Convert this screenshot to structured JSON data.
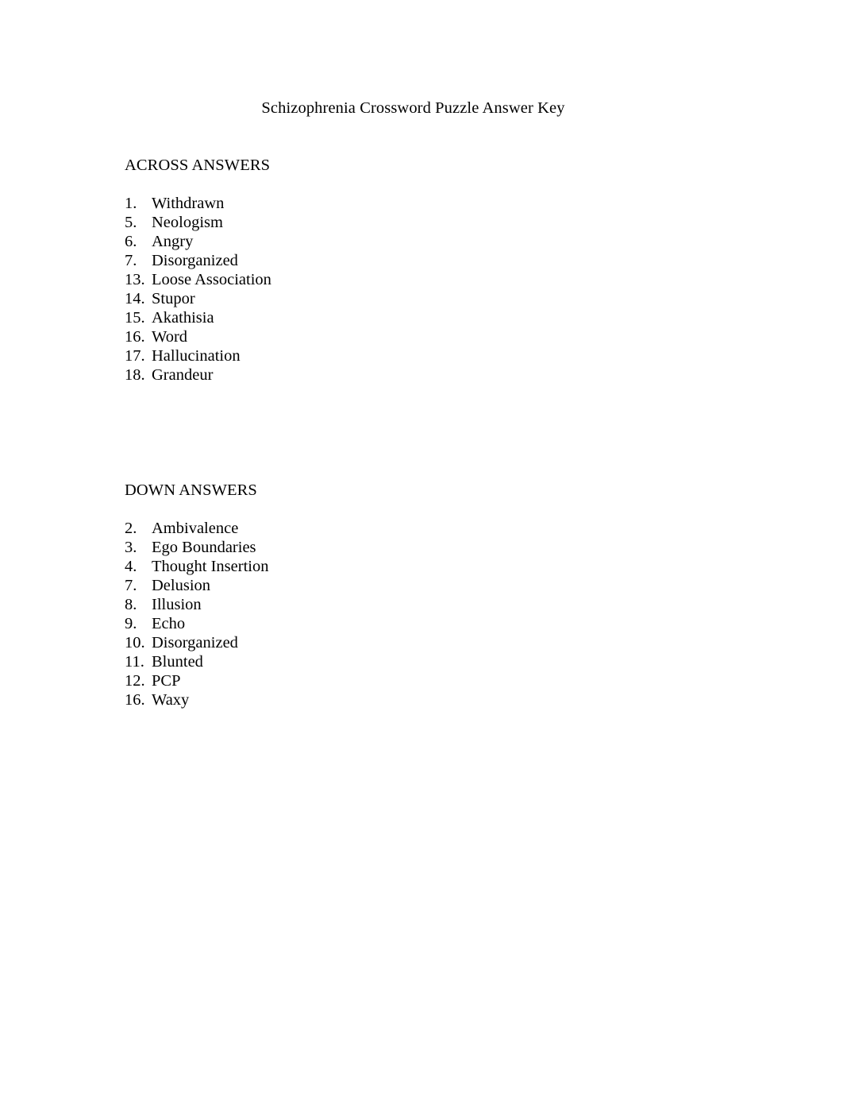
{
  "document": {
    "title": "Schizophrenia Crossword Puzzle Answer Key",
    "background_color": "#ffffff",
    "text_color": "#000000"
  },
  "across": {
    "heading": "ACROSS ANSWERS",
    "items": [
      {
        "number": "1.",
        "answer": "Withdrawn"
      },
      {
        "number": "5.",
        "answer": "Neologism"
      },
      {
        "number": "6.",
        "answer": "Angry"
      },
      {
        "number": "7.",
        "answer": "Disorganized"
      },
      {
        "number": "13.",
        "answer": "Loose Association"
      },
      {
        "number": "14.",
        "answer": "Stupor"
      },
      {
        "number": "15.",
        "answer": "Akathisia"
      },
      {
        "number": "16.",
        "answer": "Word"
      },
      {
        "number": "17.",
        "answer": "Hallucination"
      },
      {
        "number": "18.",
        "answer": "Grandeur"
      }
    ]
  },
  "down": {
    "heading": "DOWN ANSWERS",
    "items": [
      {
        "number": "2.",
        "answer": "Ambivalence"
      },
      {
        "number": "3.",
        "answer": "Ego Boundaries"
      },
      {
        "number": "4.",
        "answer": "Thought Insertion"
      },
      {
        "number": "7.",
        "answer": "Delusion"
      },
      {
        "number": "8.",
        "answer": "Illusion"
      },
      {
        "number": "9.",
        "answer": "Echo"
      },
      {
        "number": "10.",
        "answer": "Disorganized"
      },
      {
        "number": "11.",
        "answer": "Blunted"
      },
      {
        "number": "12.",
        "answer": "PCP"
      },
      {
        "number": "16.",
        "answer": "Waxy"
      }
    ]
  }
}
